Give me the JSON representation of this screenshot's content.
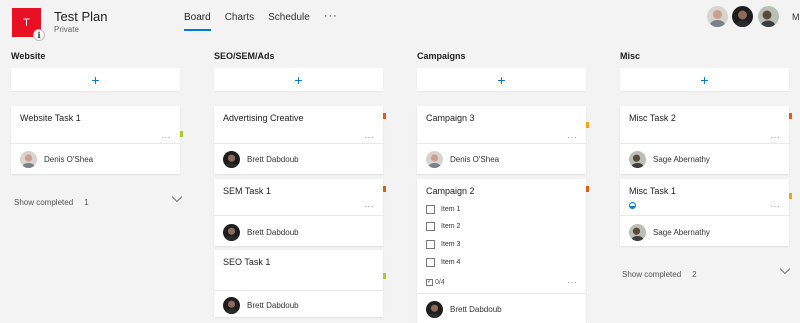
{
  "plan": {
    "initial": "T",
    "title": "Test Plan",
    "privacy": "Private",
    "color": "#e81123"
  },
  "nav": {
    "tabs": [
      "Board",
      "Charts",
      "Schedule"
    ],
    "active": "Board",
    "more": "···"
  },
  "members": {
    "more_label": "M"
  },
  "colors": {
    "accent": "#0078d4",
    "red_label": "#e8590c",
    "orange_label": "#f7a11a",
    "green_label": "#a4cc2a"
  },
  "buckets": [
    {
      "title": "Website",
      "add_label": "+",
      "tasks": [
        {
          "title": "Website Task 1",
          "assignee": "Denis O'Shea",
          "label": "green"
        }
      ],
      "show_completed": {
        "label": "Show completed",
        "count": "1"
      }
    },
    {
      "title": "SEO/SEM/Ads",
      "add_label": "+",
      "tasks": [
        {
          "title": "Advertising Creative",
          "assignee": "Brett Dabdoub",
          "label": "red"
        },
        {
          "title": "SEM Task 1",
          "assignee": "Brett Dabdoub",
          "label": "red"
        },
        {
          "title": "SEO Task 1",
          "assignee": "Brett Dabdoub",
          "label": "green"
        }
      ]
    },
    {
      "title": "Campaigns",
      "add_label": "+",
      "tasks": [
        {
          "title": "Campaign 3",
          "assignee": "Denis O'Shea",
          "label": "orange"
        },
        {
          "title": "Campaign 2",
          "assignee": "Brett Dabdoub",
          "label": "red",
          "checklist": [
            "Item 1",
            "Item 2",
            "Item 3",
            "Item 4"
          ],
          "checklist_progress": "0/4"
        }
      ]
    },
    {
      "title": "Misc",
      "add_label": "+",
      "tasks": [
        {
          "title": "Misc Task 2",
          "assignee": "Sage Abernathy",
          "label": "red"
        },
        {
          "title": "Misc Task 1",
          "assignee": "Sage Abernathy",
          "label": "orange",
          "progress": 0.5
        }
      ],
      "show_completed": {
        "label": "Show completed",
        "count": "2"
      }
    }
  ],
  "card_more": "···"
}
